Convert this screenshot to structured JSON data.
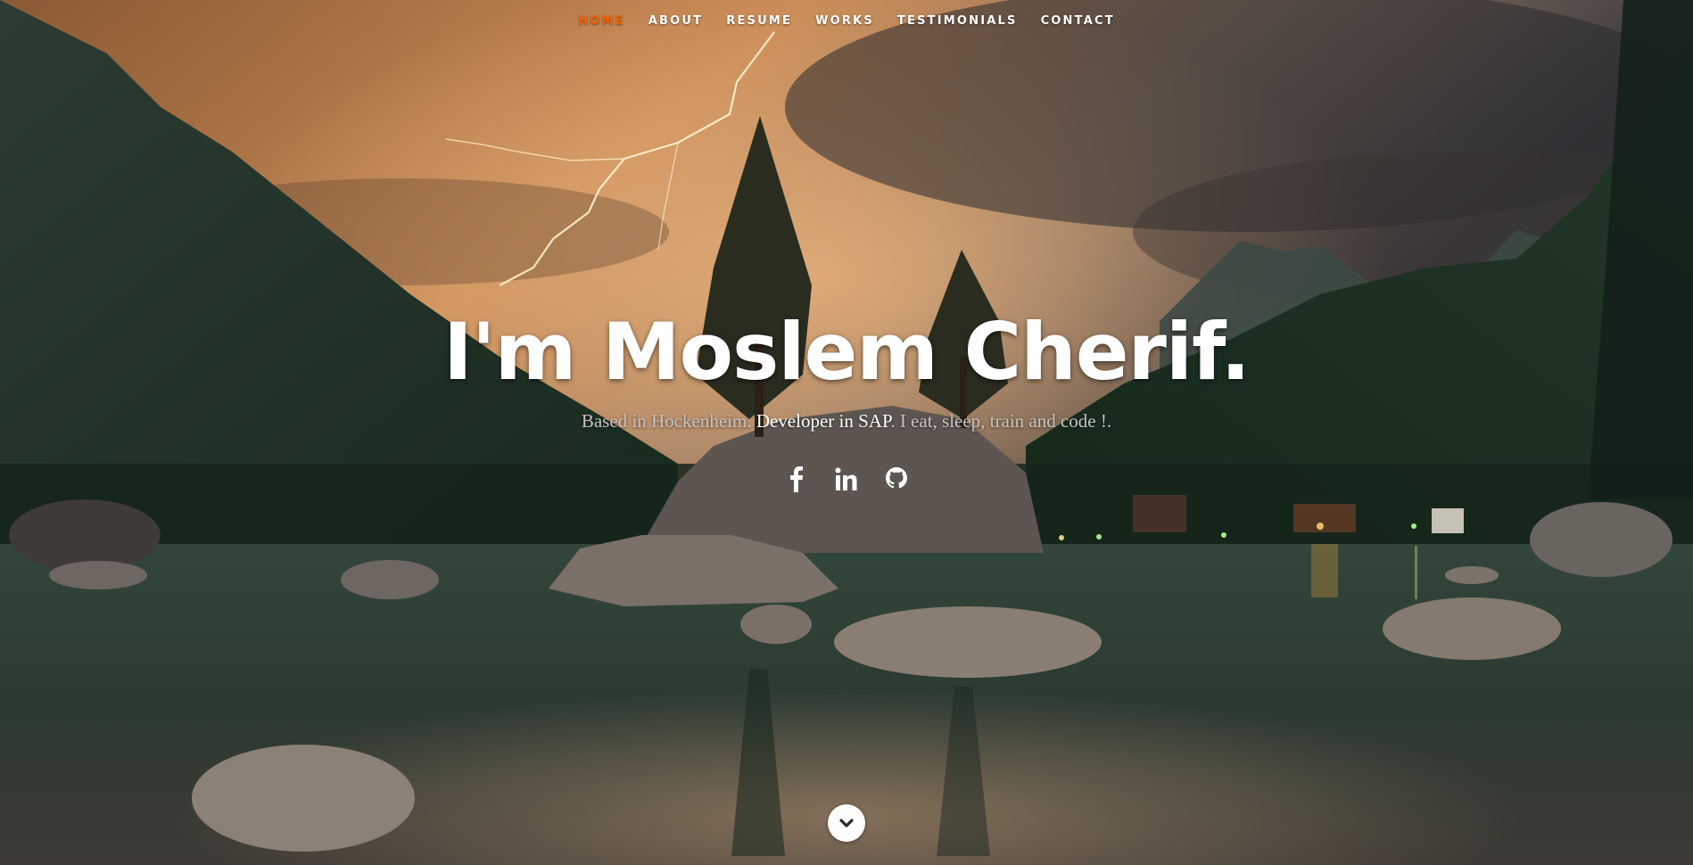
{
  "nav": {
    "items": [
      {
        "label": "HOME",
        "current": true
      },
      {
        "label": "ABOUT",
        "current": false
      },
      {
        "label": "RESUME",
        "current": false
      },
      {
        "label": "WORKS",
        "current": false
      },
      {
        "label": "TESTIMONIALS",
        "current": false
      },
      {
        "label": "CONTACT",
        "current": false
      }
    ],
    "current_color": "#F06000",
    "text_color": "#FFFFFF"
  },
  "banner": {
    "headline": "I'm Moslem Cherif.",
    "tagline_lead": "Based in Hockenheim. ",
    "tagline_strong": "Developer in SAP",
    "tagline_tail": ". I eat, sleep, train and code !."
  },
  "social": [
    {
      "icon": "facebook-icon"
    },
    {
      "icon": "linkedin-icon"
    },
    {
      "icon": "github-icon"
    }
  ],
  "scroll": {
    "icon": "chevron-down-icon"
  },
  "background": {
    "description_colors": {
      "sky_warm": "#C98A55",
      "sky_dark": "#2B2B2E",
      "forest": "#1F3A28",
      "water": "#2E3F33"
    }
  }
}
